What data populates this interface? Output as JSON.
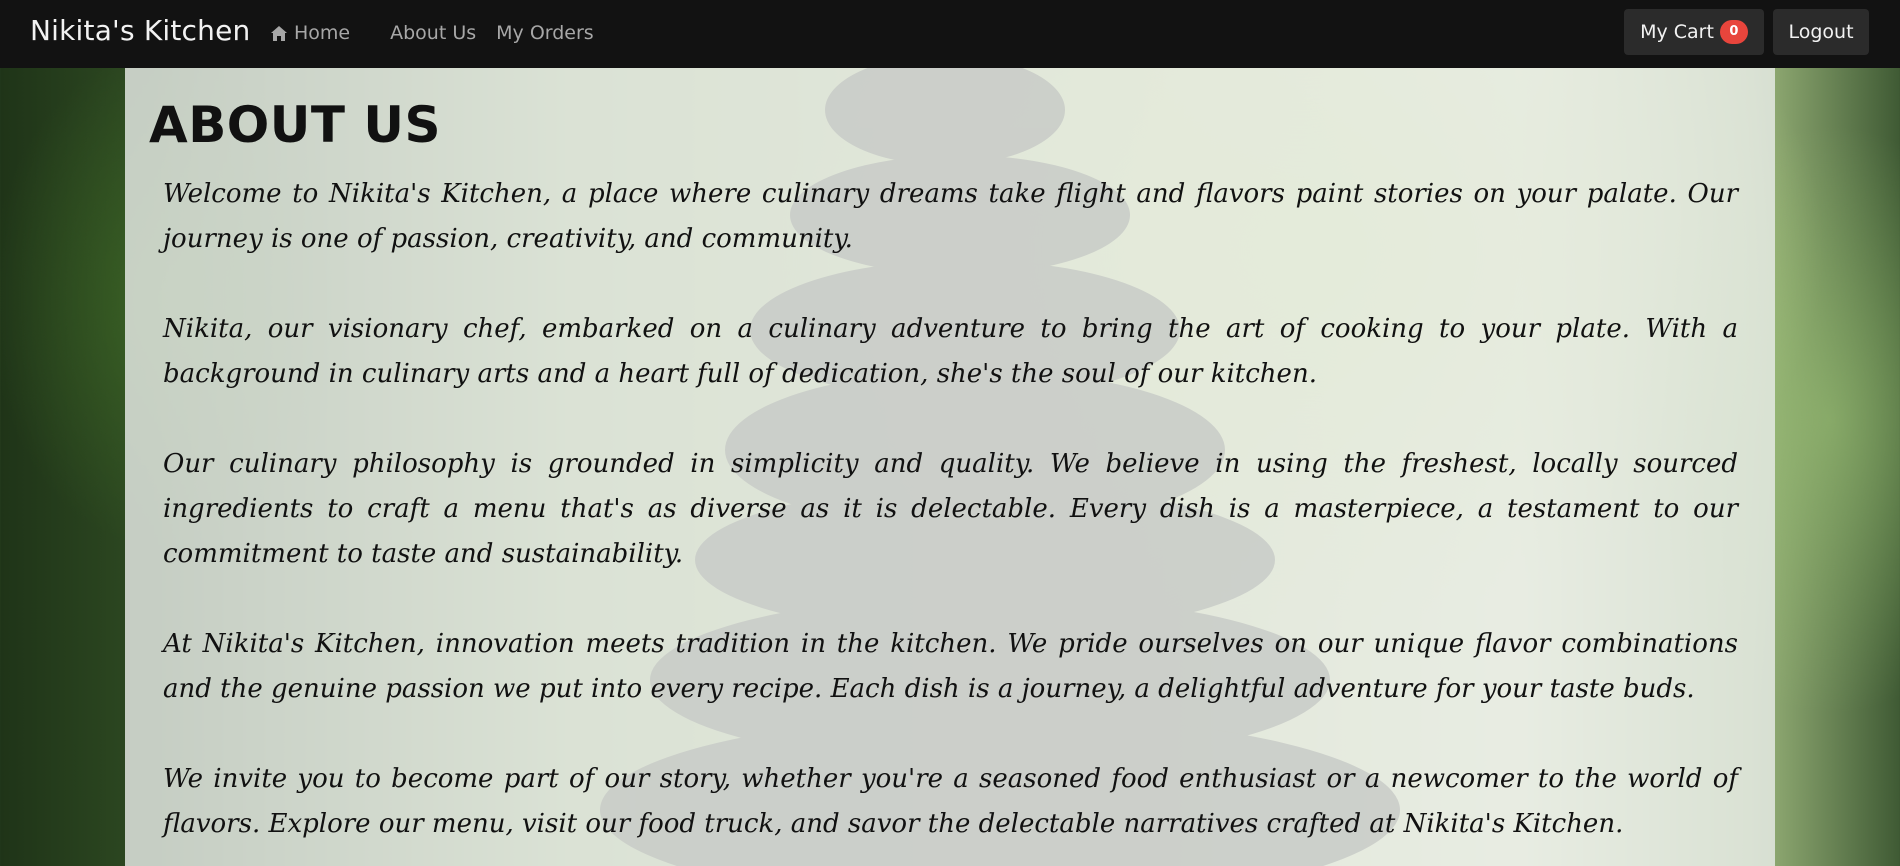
{
  "navbar": {
    "brand": "Nikita's Kitchen",
    "links": [
      {
        "label": "Home",
        "icon": "home-icon"
      },
      {
        "label": "About Us"
      },
      {
        "label": "My Orders"
      }
    ],
    "cart_label": "My Cart",
    "cart_count": "0",
    "logout_label": "Logout"
  },
  "main": {
    "title": "ABOUT US",
    "paragraphs": [
      "Welcome to Nikita's Kitchen, a place where culinary dreams take flight and flavors paint stories on your palate. Our journey is one of passion, creativity, and community.",
      "Nikita, our visionary chef, embarked on a culinary adventure to bring the art of cooking to your plate. With a background in culinary arts and a heart full of dedication, she's the soul of our kitchen.",
      "Our culinary philosophy is grounded in simplicity and quality. We believe in using the freshest, locally sourced ingredients to craft a menu that's as diverse as it is delectable. Every dish is a masterpiece, a testament to our commitment to taste and sustainability.",
      "At Nikita's Kitchen, innovation meets tradition in the kitchen. We pride ourselves on our unique flavor combinations and the genuine passion we put into every recipe. Each dish is a journey, a delightful adventure for your taste buds.",
      "We invite you to become part of our story, whether you're a seasoned food enthusiast or a newcomer to the world of flavors. Explore our menu, visit our food truck, and savor the delectable narratives crafted at Nikita's Kitchen."
    ]
  },
  "colors": {
    "navbar_bg": "#121212",
    "button_bg": "#2b2b2b",
    "badge_bg": "#e8453c",
    "nav_link": "#a7a7a7"
  }
}
